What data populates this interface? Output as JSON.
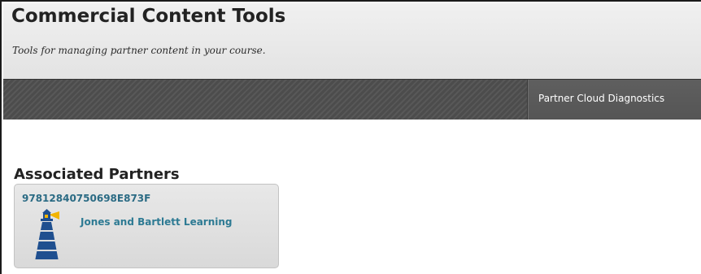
{
  "header": {
    "title": "Commercial Content Tools",
    "subtitle": "Tools for managing partner content in your course."
  },
  "action_bar": {
    "buttons": [
      {
        "label": "Partner Cloud Diagnostics"
      }
    ]
  },
  "main": {
    "section_heading": "Associated Partners",
    "partners": [
      {
        "id": "97812840750698E873F",
        "name": "Jones and Bartlett Learning",
        "logo_icon": "lighthouse-icon"
      }
    ]
  },
  "colors": {
    "header_bg": "#e6e6e6",
    "action_bar_bg": "#4f4f4f",
    "link": "#2d7a93",
    "logo_tower": "#1f4f8f",
    "logo_light": "#f2b400"
  }
}
